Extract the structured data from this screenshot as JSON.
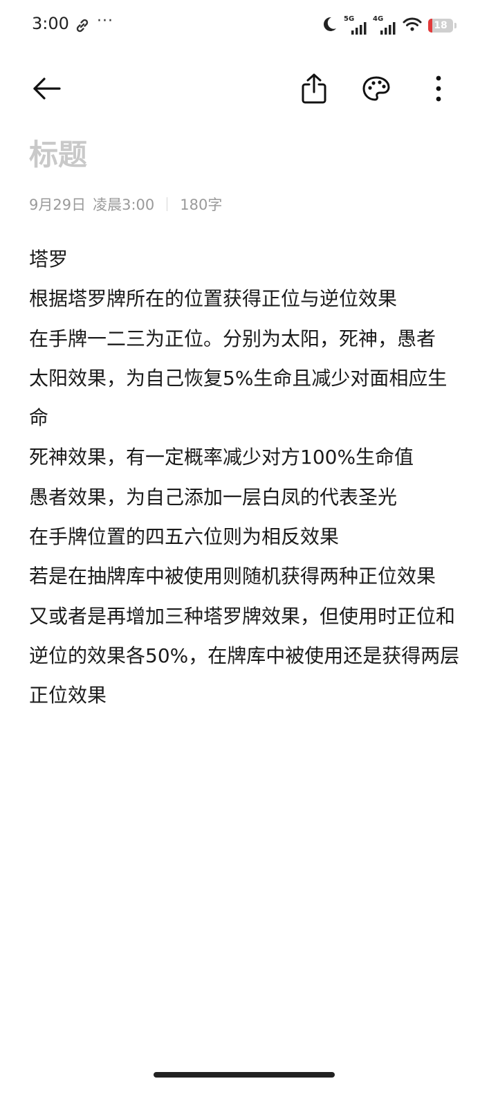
{
  "status_bar": {
    "time": "3:00",
    "dots": "···",
    "signal1_tag": "5G",
    "signal2_tag": "4G",
    "battery": "18",
    "battery_fraction": 0.18,
    "icons": [
      "link-icon",
      "moon-icon",
      "signal-icon",
      "wifi-icon",
      "battery-icon"
    ]
  },
  "toolbar": {
    "icons": [
      "back-arrow-icon",
      "share-icon",
      "palette-icon",
      "more-vertical-icon"
    ]
  },
  "note": {
    "title_placeholder": "标题",
    "date": "9月29日",
    "time": "凌晨3:00",
    "word_count": "180字",
    "lines": [
      "塔罗",
      "根据塔罗牌所在的位置获得正位与逆位效果",
      "在手牌一二三为正位。分别为太阳，死神，愚者",
      "太阳效果，为自己恢复5%生命且减少对面相应生命",
      "死神效果，有一定概率减少对方100%生命值",
      "愚者效果，为自己添加一层白凤的代表圣光",
      "在手牌位置的四五六位则为相反效果",
      "若是在抽牌库中被使用则随机获得两种正位效果",
      "又或者是再增加三种塔罗牌效果，但使用时正位和逆位的效果各50%，在牌库中被使用还是获得两层正位效果"
    ]
  }
}
